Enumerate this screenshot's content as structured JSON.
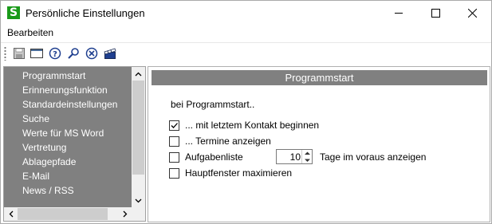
{
  "window": {
    "title": "Persönliche Einstellungen",
    "logo_letter": "S"
  },
  "menu": {
    "items": [
      "Bearbeiten"
    ]
  },
  "toolbar": {
    "icons": [
      "save-icon",
      "window-icon",
      "help-icon",
      "search-icon",
      "cancel-icon",
      "clapperboard-icon"
    ]
  },
  "nav": {
    "items": [
      "Programmstart",
      "Erinnerungsfunktion",
      "Standardeinstellungen",
      "Suche",
      "Werte für MS Word",
      "Vertretung",
      "Ablagepfade",
      "E-Mail",
      "News / RSS"
    ]
  },
  "content": {
    "header": "Programmstart",
    "intro": "bei Programmstart..",
    "options": [
      {
        "label": "... mit letztem Kontakt beginnen",
        "checked": true
      },
      {
        "label": "... Termine anzeigen",
        "checked": false
      },
      {
        "label": "Aufgabenliste",
        "checked": false
      },
      {
        "label": "Hauptfenster maximieren",
        "checked": false
      }
    ],
    "days_value": "10",
    "days_suffix": "Tage im voraus anzeigen"
  },
  "colors": {
    "nav_background": "#808080",
    "header_background": "#808080",
    "logo_green": "#1a9a1a"
  }
}
